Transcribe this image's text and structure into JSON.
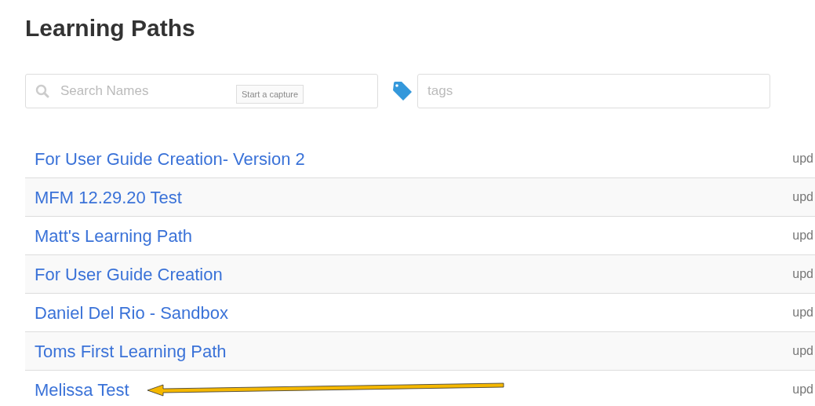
{
  "title": "Learning Paths",
  "search": {
    "placeholder": "Search Names",
    "capture_button": "Start a capture"
  },
  "tags": {
    "placeholder": "tags"
  },
  "paths": [
    {
      "name": "For User Guide Creation- Version 2",
      "updated": "upd"
    },
    {
      "name": "MFM 12.29.20 Test",
      "updated": "upd"
    },
    {
      "name": "Matt's Learning Path",
      "updated": "upd"
    },
    {
      "name": "For User Guide Creation",
      "updated": "upd"
    },
    {
      "name": "Daniel Del Rio - Sandbox",
      "updated": "upd"
    },
    {
      "name": "Toms First Learning Path",
      "updated": "upd"
    },
    {
      "name": "Melissa Test",
      "updated": "upd",
      "highlighted": true
    }
  ]
}
